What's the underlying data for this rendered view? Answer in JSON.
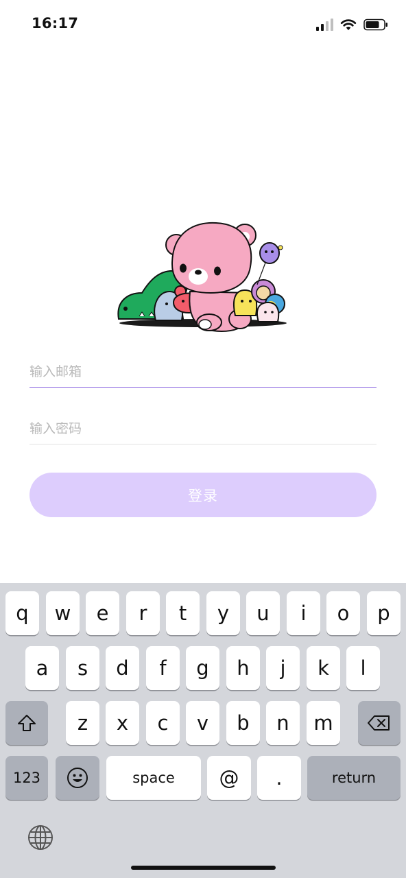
{
  "status_bar": {
    "time": "16:17",
    "icons": [
      "cellular-signal-icon",
      "wifi-icon",
      "battery-icon"
    ]
  },
  "illustration": {
    "description_icon": "cartoon-characters-icon"
  },
  "form": {
    "email_placeholder": "输入邮箱",
    "email_value": "",
    "password_placeholder": "输入密码",
    "password_value": "",
    "login_label": "登录"
  },
  "keyboard": {
    "row1": [
      "q",
      "w",
      "e",
      "r",
      "t",
      "y",
      "u",
      "i",
      "o",
      "p"
    ],
    "row2": [
      "a",
      "s",
      "d",
      "f",
      "g",
      "h",
      "j",
      "k",
      "l"
    ],
    "row3": [
      "z",
      "x",
      "c",
      "v",
      "b",
      "n",
      "m"
    ],
    "numbers_label": "123",
    "space_label": "space",
    "at_label": "@",
    "dot_label": ".",
    "return_label": "return"
  },
  "colors": {
    "accent": "#8a66e0",
    "button_disabled": "#ddcdfd",
    "keyboard_bg": "#d4d6db",
    "function_key": "#acb0b9"
  }
}
